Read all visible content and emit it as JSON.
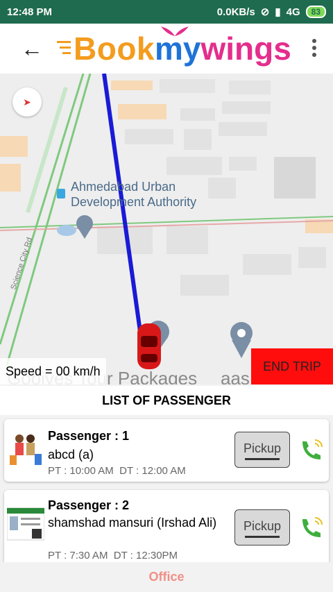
{
  "status_bar": {
    "time": "12:48 PM",
    "net_speed": "0.0KB/s",
    "network": "4G",
    "battery": "83"
  },
  "header": {
    "logo_part1": "Book",
    "logo_part2": "my",
    "logo_part3": "wings",
    "back_icon": "arrow-left-icon",
    "menu_icon": "more-vertical-icon"
  },
  "map": {
    "poi_line1": "Ahmedabad Urban",
    "poi_line2": "Development Authority",
    "road_label": "Science City Rd",
    "speed_text": "Speed = 00 km/h",
    "end_trip_label": "END TRIP",
    "bottom_text_left": "Gooives Tour Packages",
    "bottom_text_right": "aas"
  },
  "passenger_section": {
    "title": "LIST OF PASSENGER",
    "passengers": [
      {
        "label": "Passenger : 1",
        "name": "abcd (a)",
        "pt": "PT : 10:00 AM",
        "dt": "DT : 12:00 AM",
        "action": "Pickup"
      },
      {
        "label": "Passenger : 2",
        "name": "shamshad mansuri (Irshad Ali)",
        "pt": "PT : 7:30 AM",
        "dt": "DT : 12:30PM",
        "action": "Pickup"
      }
    ]
  },
  "bottom_tab": {
    "label": "Office"
  },
  "colors": {
    "status_bar": "#1f6b4f",
    "end_trip": "#ff0d0d",
    "route": "#1a1ad6",
    "office_tab": "#f08f86"
  }
}
